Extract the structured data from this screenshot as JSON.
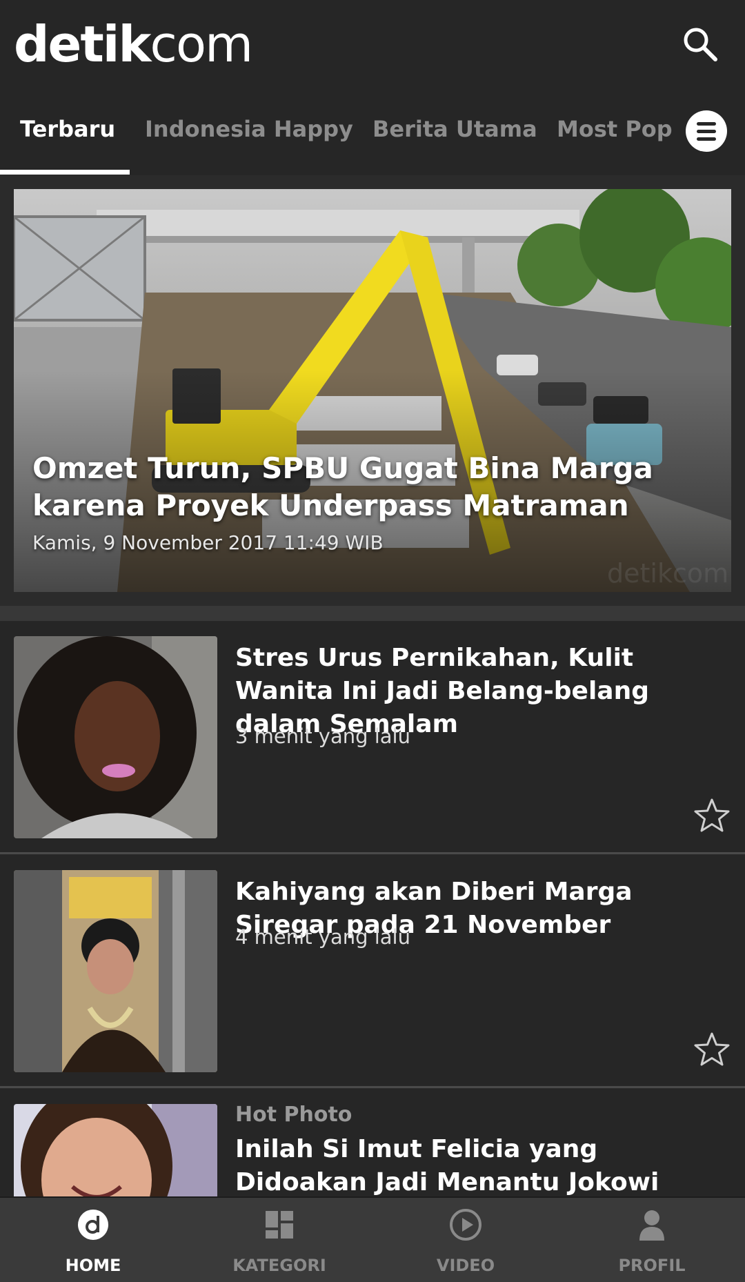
{
  "header": {
    "logo_bold": "detik",
    "logo_light": "com",
    "search_icon": "search-icon",
    "menu_icon": "menu-icon"
  },
  "tabs": [
    {
      "label": "Terbaru",
      "active": true
    },
    {
      "label": "Indonesia Happy",
      "active": false
    },
    {
      "label": "Berita Utama",
      "active": false
    },
    {
      "label": "Most Pop",
      "active": false
    }
  ],
  "hero": {
    "title": "Omzet Turun, SPBU Gugat Bina Marga karena Proyek Underpass Matraman",
    "date": "Kamis, 9 November 2017 11:49 WIB",
    "image": "excavator-construction-photo"
  },
  "articles": [
    {
      "category": "",
      "title": "Stres Urus Pernikahan, Kulit Wanita Ini Jadi Belang-belang dalam Semalam",
      "time": "3 menit yang lalu",
      "image": "woman-portrait-photo",
      "bookmark_icon": "star-icon"
    },
    {
      "category": "",
      "title": "Kahiyang akan Diberi Marga Siregar pada 21 November",
      "time": "4 menit yang lalu",
      "image": "bride-traditional-photo",
      "bookmark_icon": "star-icon"
    },
    {
      "category": "Hot Photo",
      "title": "Inilah Si Imut Felicia yang Didoakan Jadi Menantu Jokowi Berikutnya",
      "time": "",
      "image": "girl-selfie-photo"
    }
  ],
  "bottom_nav": [
    {
      "label": "HOME",
      "icon": "home-icon",
      "active": true
    },
    {
      "label": "KATEGORI",
      "icon": "grid-icon",
      "active": false
    },
    {
      "label": "VIDEO",
      "icon": "play-icon",
      "active": false
    },
    {
      "label": "PROFIL",
      "icon": "person-icon",
      "active": false
    }
  ],
  "colors": {
    "background": "#262626",
    "nav_background": "#3a3a3a",
    "active": "#ffffff",
    "inactive": "#8d8d8d"
  }
}
